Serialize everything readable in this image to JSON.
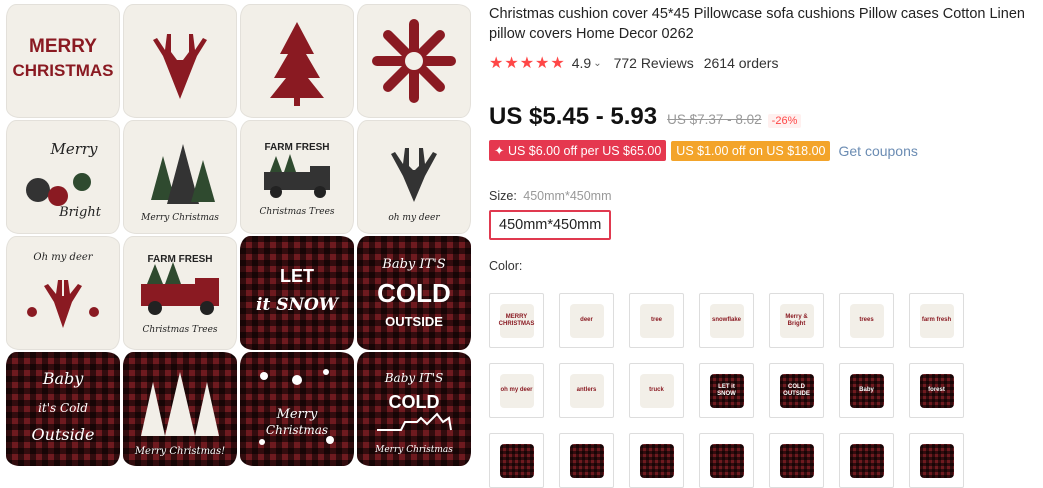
{
  "gallery": {
    "pillows": [
      {
        "style": "light",
        "text": "MERRY CHRISTMAS",
        "motif": "text"
      },
      {
        "style": "light",
        "text": "",
        "motif": "deer-head"
      },
      {
        "style": "light",
        "text": "",
        "motif": "tree"
      },
      {
        "style": "light",
        "text": "",
        "motif": "snowflake"
      },
      {
        "style": "light",
        "text": "Merry & Bright",
        "motif": "ornaments"
      },
      {
        "style": "light",
        "text": "Merry Christmas",
        "motif": "trees"
      },
      {
        "style": "light",
        "text": "FARM FRESH Christmas Trees",
        "motif": "truck"
      },
      {
        "style": "light",
        "text": "oh my deer",
        "motif": "deer-head"
      },
      {
        "style": "light",
        "text": "Oh my deer",
        "motif": "antlers"
      },
      {
        "style": "light",
        "text": "FARM FRESH Christmas Trees",
        "motif": "truck"
      },
      {
        "style": "plaid",
        "text": "LET it SNOW",
        "motif": "text"
      },
      {
        "style": "plaid",
        "text": "Baby IT'S COLD OUTSIDE",
        "motif": "text"
      },
      {
        "style": "plaid",
        "text": "Baby it's Cold Outside",
        "motif": "text"
      },
      {
        "style": "plaid",
        "text": "Merry Christmas!",
        "motif": "forest"
      },
      {
        "style": "plaid",
        "text": "Merry Christmas",
        "motif": "snowflakes"
      },
      {
        "style": "plaid",
        "text": "Merry Christmas",
        "motif": "sleigh"
      }
    ]
  },
  "product": {
    "title": "Christmas cushion cover 45*45 Pillowcase sofa cushions Pillow cases Cotton Linen pillow covers Home Decor 0262",
    "stars": "★★★★★",
    "score": "4.9",
    "chevron": "⌄",
    "reviews": "772 Reviews",
    "orders": "2614 orders",
    "price": "US $5.45 - 5.93",
    "original_price": "US $7.37 - 8.02",
    "discount": "-26%",
    "coupon1": "✦ US $6.00 off per US $65.00",
    "coupon2": "US $1.00 off on US $18.00",
    "get_coupons": "Get coupons",
    "size_label": "Size:",
    "size_value": "450mm*450mm",
    "size_option": "450mm*450mm",
    "color_label": "Color:"
  },
  "colors": {
    "accent": "#ff4747",
    "coupon_red": "#e5384f",
    "coupon_orange": "#f3a42a",
    "link": "#6b8cb3"
  },
  "swatches": [
    {
      "style": "light",
      "label": "MERRY CHRISTMAS"
    },
    {
      "style": "light",
      "label": "deer"
    },
    {
      "style": "light",
      "label": "tree"
    },
    {
      "style": "light",
      "label": "snowflake"
    },
    {
      "style": "light",
      "label": "Merry & Bright"
    },
    {
      "style": "light",
      "label": "trees"
    },
    {
      "style": "light",
      "label": "farm fresh"
    },
    {
      "style": "light",
      "label": "oh my deer"
    },
    {
      "style": "light",
      "label": "antlers"
    },
    {
      "style": "light",
      "label": "truck"
    },
    {
      "style": "plaid",
      "label": "LET it SNOW"
    },
    {
      "style": "plaid",
      "label": "COLD OUTSIDE"
    },
    {
      "style": "plaid",
      "label": "Baby"
    },
    {
      "style": "plaid",
      "label": "forest"
    },
    {
      "style": "plaid",
      "label": ""
    },
    {
      "style": "plaid",
      "label": ""
    },
    {
      "style": "plaid",
      "label": ""
    },
    {
      "style": "plaid",
      "label": ""
    },
    {
      "style": "plaid",
      "label": ""
    },
    {
      "style": "plaid",
      "label": ""
    },
    {
      "style": "plaid",
      "label": ""
    }
  ]
}
